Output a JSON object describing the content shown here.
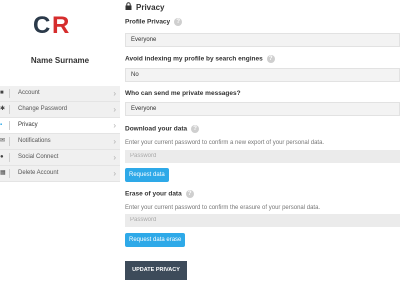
{
  "brand": {
    "logo_text": "CR",
    "logo_color_c": "#2b3a4a",
    "logo_color_r": "#d62d2d"
  },
  "profile": {
    "name": "Name Surname"
  },
  "menu": {
    "items": [
      {
        "label": "Account",
        "icon": "user-icon",
        "active": false
      },
      {
        "label": "Change Password",
        "icon": "key-icon",
        "active": false
      },
      {
        "label": "Privacy",
        "icon": "lock-icon",
        "active": true
      },
      {
        "label": "Notifications",
        "icon": "envelope-icon",
        "active": false
      },
      {
        "label": "Social Connect",
        "icon": "share-icon",
        "active": false
      },
      {
        "label": "Delete Account",
        "icon": "trash-icon",
        "active": false
      }
    ]
  },
  "page": {
    "title": "Privacy"
  },
  "privacy": {
    "profile_privacy": {
      "label": "Profile Privacy",
      "help": "?",
      "value": "Everyone"
    },
    "indexing": {
      "label": "Avoid indexing my profile by search engines",
      "help": "?",
      "value": "No"
    },
    "messages": {
      "label": "Who can send me private messages?",
      "value": "Everyone"
    }
  },
  "download": {
    "label": "Download your data",
    "help": "?",
    "description": "Enter your current password to confirm a new export of your personal data.",
    "password_placeholder": "Password",
    "button": "Request data"
  },
  "erase": {
    "label": "Erase of your data",
    "help": "?",
    "description": "Enter your current password to confirm the erasure of your personal data.",
    "password_placeholder": "Password",
    "button": "Request data erase"
  },
  "submit": {
    "label": "UPDATE PRIVACY"
  },
  "colors": {
    "accent": "#2ea9e8",
    "submit_bg": "#3d4b5a"
  }
}
